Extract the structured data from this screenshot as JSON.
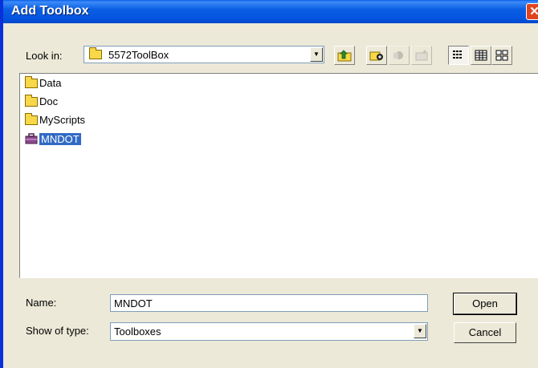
{
  "title": "Add Toolbox",
  "close_glyph": "✕",
  "look_in": {
    "label": "Look in:",
    "value": "5572ToolBox"
  },
  "files": [
    {
      "name": "Data",
      "icon": "folder-icon",
      "selected": false
    },
    {
      "name": "Doc",
      "icon": "folder-icon",
      "selected": false
    },
    {
      "name": "MyScripts",
      "icon": "folder-icon",
      "selected": false
    },
    {
      "name": "MNDOT",
      "icon": "toolbox-icon",
      "selected": true
    }
  ],
  "name_field": {
    "label": "Name:",
    "value": "MNDOT"
  },
  "type_field": {
    "label": "Show of type:",
    "value": "Toolboxes"
  },
  "buttons": {
    "open": "Open",
    "cancel": "Cancel"
  },
  "colors": {
    "titlebar": "#0454e0",
    "selection": "#316ac5",
    "background": "#ece9d8"
  }
}
